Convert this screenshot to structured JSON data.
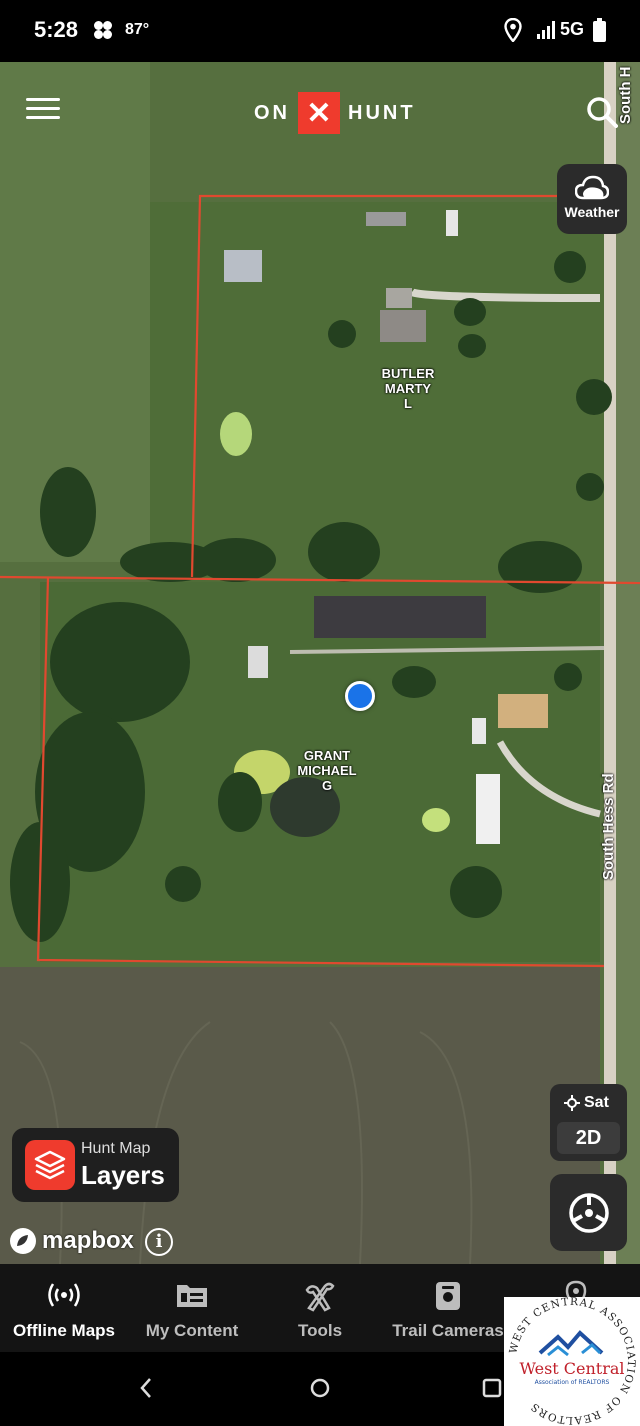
{
  "status_bar": {
    "time": "5:28",
    "temperature": "87°",
    "network": "5G"
  },
  "header": {
    "logo_left": "ON",
    "logo_mark": "✕",
    "logo_right": "HUNT"
  },
  "weather_button": {
    "label": "Weather"
  },
  "map": {
    "parcels": [
      {
        "label": "BUTLER\nMARTY\nL"
      },
      {
        "label": "GRANT\nMICHAEL\nG"
      }
    ],
    "roads": [
      {
        "label": "South Hess Rd"
      },
      {
        "label": "South H"
      }
    ],
    "map_type": {
      "label": "Sat",
      "mode": "2D"
    },
    "layers_button": {
      "top": "Hunt Map",
      "bottom": "Layers"
    },
    "attribution": "mapbox",
    "parcel_line_color": "#e0492f"
  },
  "bottom_nav": {
    "items": [
      {
        "label": "Offline Maps",
        "icon": "offline-maps-icon",
        "active": true
      },
      {
        "label": "My Content",
        "icon": "folder-icon",
        "active": false
      },
      {
        "label": "Tools",
        "icon": "tools-icon",
        "active": false
      },
      {
        "label": "Trail Cameras",
        "icon": "trail-camera-icon",
        "active": false
      },
      {
        "label": "",
        "icon": "location-pin-icon",
        "active": false
      }
    ]
  },
  "watermark": {
    "ring_text": "WEST CENTRAL ASSOCIATION OF REALTORS",
    "title": "West Central",
    "subtitle": "Association of REALTORS"
  },
  "colors": {
    "accent": "#ef3b2d",
    "location_dot": "#1a73e8"
  }
}
